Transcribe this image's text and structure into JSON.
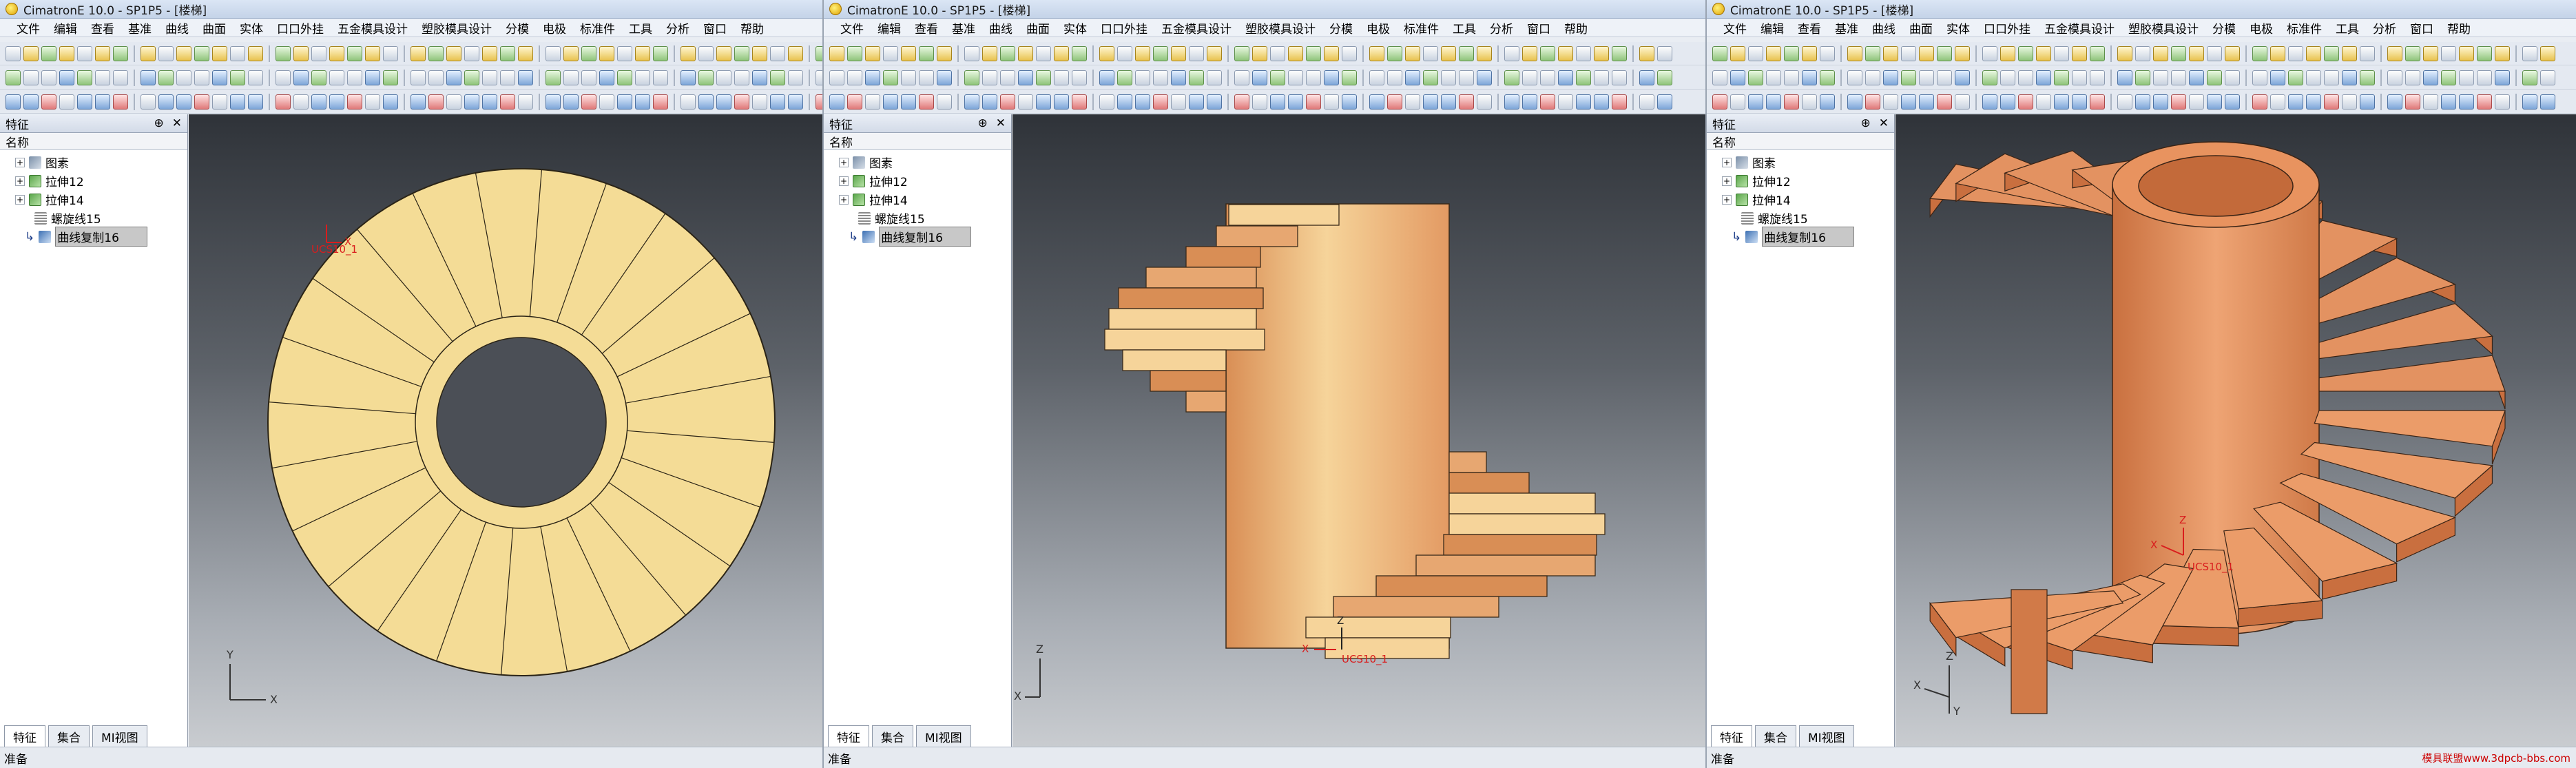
{
  "window": {
    "title": "CimatronE 10.0 - SP1P5 - [楼梯]"
  },
  "menu": [
    "文件",
    "编辑",
    "查看",
    "基准",
    "曲线",
    "曲面",
    "实体",
    "口口外挂",
    "五金模具设计",
    "塑胶模具设计",
    "分模",
    "电极",
    "标准件",
    "工具",
    "分析",
    "窗口",
    "帮助"
  ],
  "feature_panel": {
    "title": "特征",
    "pin_icon": "pin-icon",
    "close_icon": "close-icon",
    "column_header": "名称",
    "items": [
      {
        "label": "图素",
        "icon": "sketch-icon",
        "expander": "+"
      },
      {
        "label": "拉伸12",
        "icon": "extrude-icon",
        "expander": "+"
      },
      {
        "label": "拉伸14",
        "icon": "extrude-icon",
        "expander": "+"
      },
      {
        "label": "螺旋线15",
        "icon": "helix-icon",
        "expander": ""
      },
      {
        "label": "曲线复制16",
        "icon": "curve-copy-icon",
        "expander": "",
        "selected": true
      }
    ]
  },
  "bottom_tabs": [
    "特征",
    "集合",
    "MI视图"
  ],
  "status": "准备",
  "views": {
    "top": {
      "ucs_label": "UCS10_1",
      "axis_x": "X",
      "axis_y": "Y"
    },
    "front": {
      "ucs_label": "UCS10_1",
      "axis_x": "X",
      "axis_z": "Z"
    },
    "iso": {
      "ucs_label": "UCS10_1",
      "axis_x": "X",
      "axis_y": "Y",
      "axis_z": "Z"
    }
  },
  "watermark": "模具联盟www.3dpcb-bbs.com",
  "colors": {
    "top_fill": "#f4dc96",
    "front_light": "#f6d49a",
    "front_dark": "#d98e55",
    "iso_fill": "#e38d5c",
    "ucs_red": "#d91d1d"
  }
}
